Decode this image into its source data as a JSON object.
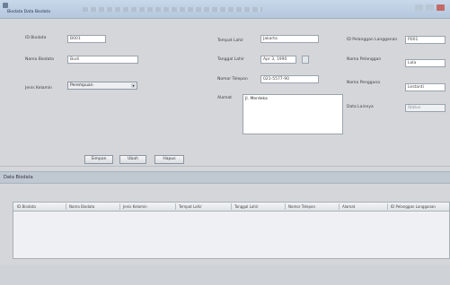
{
  "window": {
    "title": "Biodata Data Biodata",
    "section_detail": "Data Biodata"
  },
  "form": {
    "id_anak_label": "ID Biodata",
    "id_anak_value": "B001",
    "nama_label": "Nama Biodata",
    "nama_value": "Budi",
    "jenis_kelamin_label": "Jenis Kelamin",
    "jenis_kelamin_value": "Perempuan",
    "tempat_lahir_label": "Tempat Lahir",
    "tempat_lahir_value": "Jakarta",
    "tanggal_lahir_label": "Tanggal Lahir",
    "tanggal_lahir_value": "Apr 3, 1990",
    "nomor_telepon_label": "Nomor Telepon",
    "nomor_telepon_value": "021-5577-90",
    "alamat_label": "Alamat",
    "alamat_value": "Jl. Merdeka",
    "id_pelanggan_label": "ID Pelanggan Langganan",
    "id_pelanggan_value": "P001",
    "nama_pelanggan_label": "Nama Pelanggan",
    "nama_pelanggan_value": "Lala",
    "nama_pengguna_label": "Nama Pengguna",
    "nama_pengguna_value": "Lestanti",
    "data_lainnya_label": "Data Lainnya",
    "data_lainnya_value": "Status"
  },
  "buttons": {
    "simpan": "Simpan",
    "ubah": "Ubah",
    "hapus": "Hapus"
  },
  "table": {
    "section_title": "Data Biodata",
    "columns": [
      "ID Biodata",
      "Nama Biodata",
      "Jenis Kelamin",
      "Tempat Lahir",
      "Tanggal Lahir",
      "Nomor Telepon",
      "Alamat",
      "ID Pelanggan Langganan"
    ]
  }
}
